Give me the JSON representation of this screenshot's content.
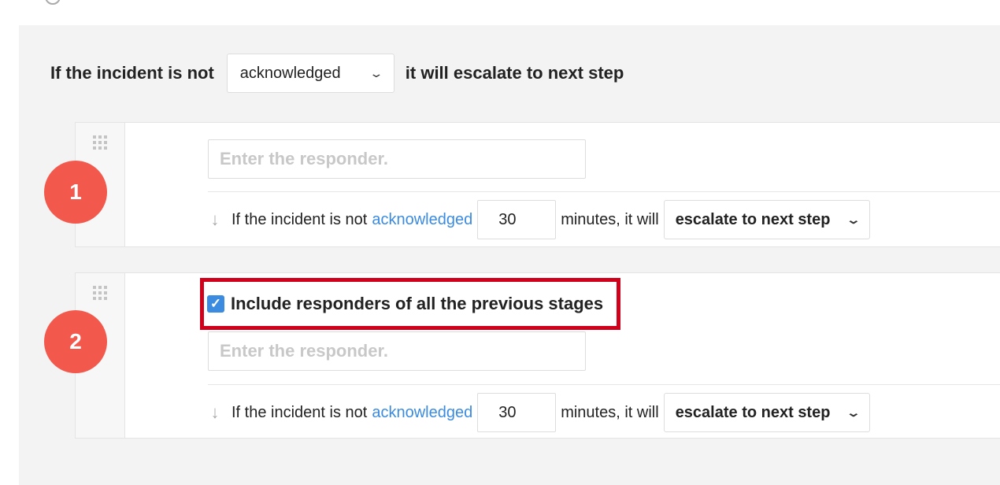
{
  "header": {
    "prefix": "If the incident is not",
    "condition": "acknowledged",
    "suffix": "it will escalate to next step"
  },
  "stages": [
    {
      "number": "1",
      "responder_placeholder": "Enter the responder.",
      "rule_prefix": "If the incident is not",
      "rule_condition": "acknowledged",
      "minutes": "30",
      "rule_middle": "minutes, it will",
      "rule_action": "escalate to next step"
    },
    {
      "number": "2",
      "include_previous_label": "Include responders of all the previous stages",
      "include_previous_checked": true,
      "responder_placeholder": "Enter the responder.",
      "rule_prefix": "If the incident is not",
      "rule_condition": "acknowledged",
      "minutes": "30",
      "rule_middle": "minutes, it will",
      "rule_action": "escalate to next step"
    }
  ],
  "icons": {
    "chevron": "chevron-down-icon",
    "drag": "drag-handle-icon",
    "arrow": "arrow-down-icon",
    "check": "checkmark-icon"
  },
  "colors": {
    "stage_badge": "#f2584b",
    "link": "#3b8be0",
    "highlight": "#d0021b",
    "panel_bg": "#f3f3f3"
  }
}
